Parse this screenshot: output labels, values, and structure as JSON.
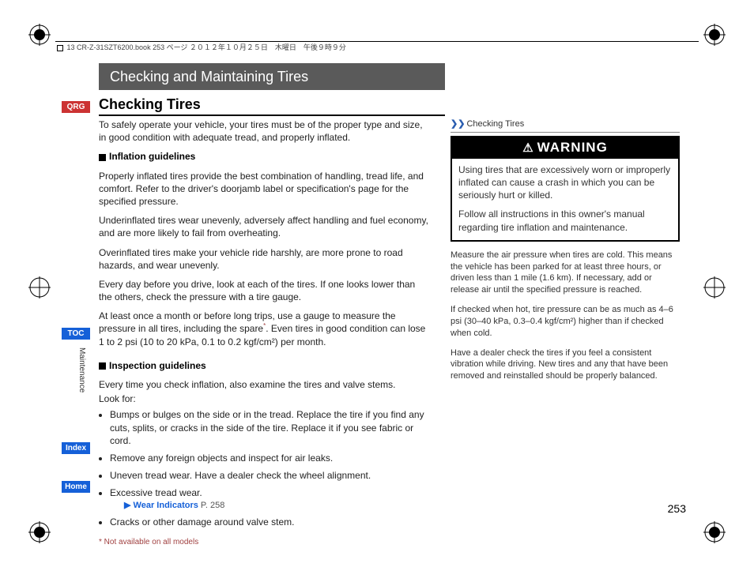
{
  "header_strip": "13 CR-Z-31SZT6200.book  253 ページ  ２０１２年１０月２５日　木曜日　午後９時９分",
  "title_bar": "Checking and Maintaining Tires",
  "section_title": "Checking Tires",
  "left": {
    "intro": "To safely operate your vehicle, your tires must be of the proper type and size, in good condition with adequate tread, and properly inflated.",
    "sub1": "Inflation guidelines",
    "p1": "Properly inflated tires provide the best combination of handling, tread life, and comfort. Refer to the driver's doorjamb label or specification's page for the specified pressure.",
    "p2": "Underinflated tires wear unevenly, adversely affect handling and fuel economy, and are more likely to fail from overheating.",
    "p3": "Overinflated tires make your vehicle ride harshly, are more prone to road hazards, and wear unevenly.",
    "p4": "Every day before you drive, look at each of the tires. If one looks lower than the others, check the pressure with a tire gauge.",
    "p5a": "At least once a month or before long trips, use a gauge to measure the pressure in all tires, including the spare",
    "p5b": ". Even tires in good condition can lose 1 to 2 psi (10 to 20 kPa, 0.1 to 0.2 kgf/cm²) per month.",
    "sub2": "Inspection guidelines",
    "p6": "Every time you check inflation, also examine the tires and valve stems.",
    "p7": "Look for:",
    "b1": "Bumps or bulges on the side or in the tread. Replace the tire if you find any cuts, splits, or cracks in the side of the tire. Replace it if you see fabric or cord.",
    "b2": "Remove any foreign objects and inspect for air leaks.",
    "b3": "Uneven tread wear. Have a dealer check the wheel alignment.",
    "b4": "Excessive tread wear.",
    "link_label": "Wear Indicators",
    "link_page": "P. 258",
    "b5": "Cracks or other damage around valve stem.",
    "footnote_mark": "*",
    "footnote": " Not available on all models"
  },
  "right": {
    "head": "Checking Tires",
    "warning_title": "WARNING",
    "w1": "Using tires that are excessively worn or improperly inflated can cause a crash in which you can be seriously hurt or killed.",
    "w2": "Follow all instructions in this owner's manual regarding tire inflation and maintenance.",
    "n1": "Measure the air pressure when tires are cold. This means the vehicle has been parked for at least three hours, or driven less than 1 mile (1.6 km). If necessary, add or release air until the specified pressure is reached.",
    "n2": "If checked when hot, tire pressure can be as much as 4–6 psi (30–40 kPa, 0.3–0.4 kgf/cm²) higher than if checked when cold.",
    "n3": "Have a dealer check the tires if you feel a consistent vibration while driving. New tires and any that have been removed and reinstalled should be properly balanced."
  },
  "nav": {
    "qrg": "QRG",
    "toc": "TOC",
    "index": "Index",
    "home": "Home"
  },
  "side_label": "Maintenance",
  "page_number": "253"
}
